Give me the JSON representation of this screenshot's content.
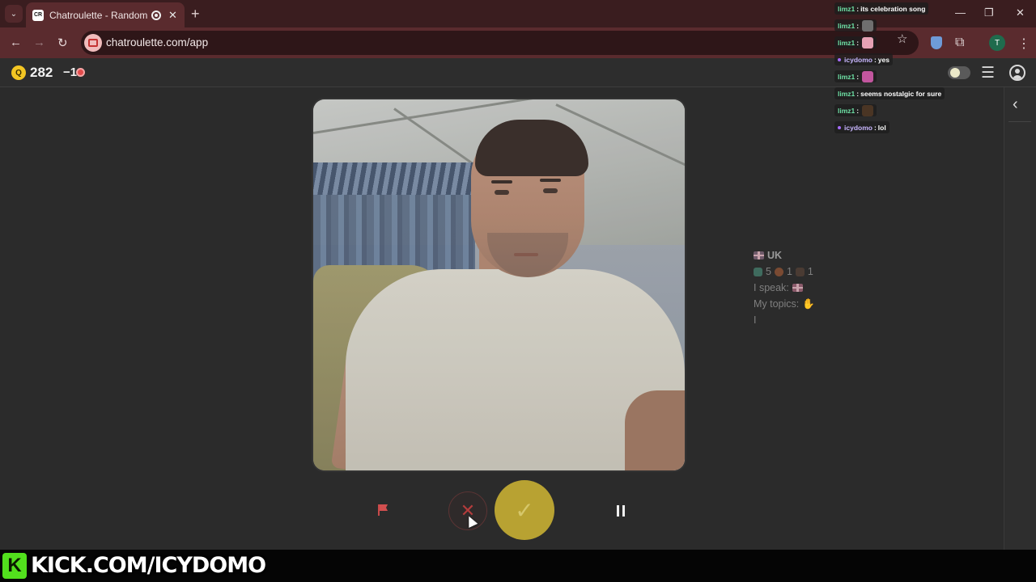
{
  "browser": {
    "tab_title": "Chatroulette - Random video chat",
    "tab_favicon_text": "CR",
    "url": "chatroulette.com/app",
    "profile_initial": "T"
  },
  "header": {
    "coin_icon_text": "Q",
    "coins": "282",
    "penalty": "−1"
  },
  "partner": {
    "country": "UK",
    "stats": [
      "5",
      "1",
      "1"
    ],
    "speak_label": "I speak:",
    "topics_label": "My topics:",
    "extra_line": "I"
  },
  "controls": {
    "skip_symbol": "✕",
    "accept_symbol": "✓"
  },
  "chat": [
    {
      "user": "limz1",
      "text": "its celebration song",
      "type": "text"
    },
    {
      "user": "limz1",
      "text": "",
      "type": "emote",
      "emote_color": "#6f6f6f"
    },
    {
      "user": "limz1",
      "text": "",
      "type": "emote",
      "emote_color": "#e6a1b4"
    },
    {
      "user": "icydomo",
      "text": "yes",
      "type": "text",
      "mod": true
    },
    {
      "user": "limz1",
      "text": "",
      "type": "emote",
      "emote_color": "#c2569e"
    },
    {
      "user": "limz1",
      "text": "seems nostalgic for sure",
      "type": "text"
    },
    {
      "user": "limz1",
      "text": "",
      "type": "emote",
      "emote_color": "#4a3524"
    },
    {
      "user": "icydomo",
      "text": "lol",
      "type": "text",
      "mod": true
    }
  ],
  "stream_overlay": {
    "logo_letter": "K",
    "channel": "KICK.COM/ICYDOMO"
  },
  "colors": {
    "accent_accept": "#b8a232",
    "skip_red": "#b33c3c",
    "browser_frame": "#5a2b2e",
    "kick_green": "#52e01d"
  }
}
